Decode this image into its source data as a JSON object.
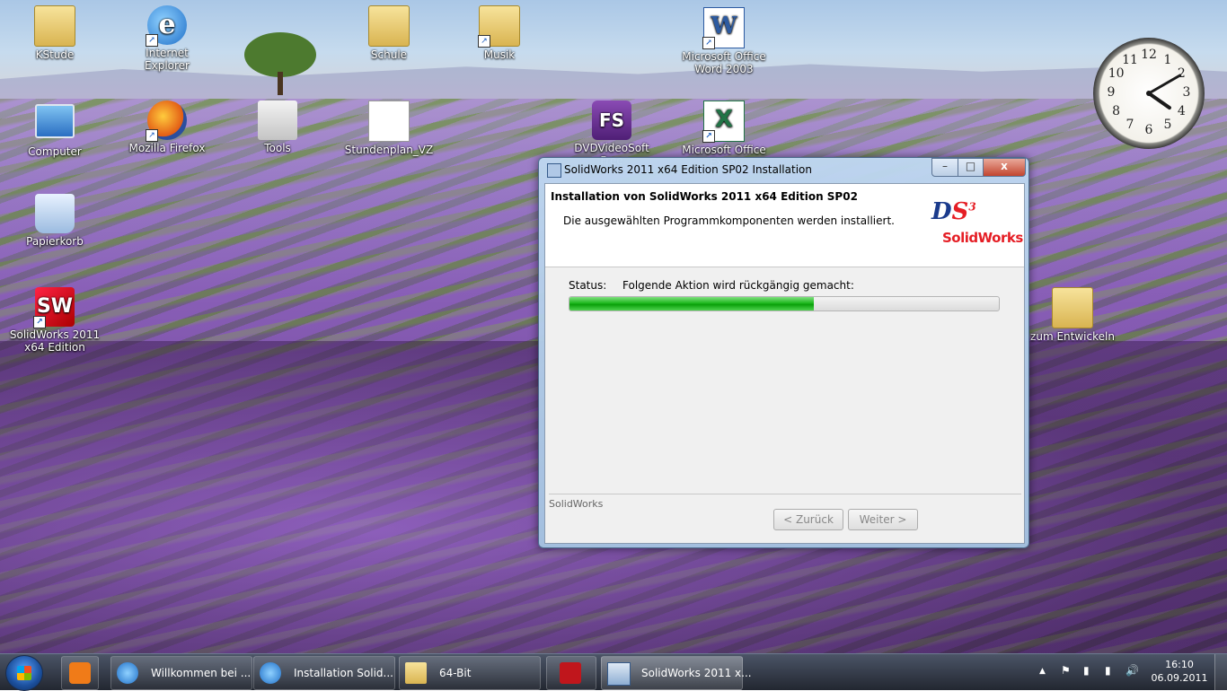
{
  "desktop_icons": [
    {
      "name": "KStude",
      "type": "folder"
    },
    {
      "name": "Internet Explorer",
      "type": "ie"
    },
    {
      "name": "Schule",
      "type": "folder"
    },
    {
      "name": "Musik",
      "type": "folder"
    },
    {
      "name": "Microsoft Office Word 2003",
      "type": "word"
    },
    {
      "name": "Computer",
      "type": "pc"
    },
    {
      "name": "Mozilla Firefox",
      "type": "ff"
    },
    {
      "name": "Tools",
      "type": "house"
    },
    {
      "name": "Stundenplan_VZ",
      "type": "doc"
    },
    {
      "name": "DVDVideoSoft Free",
      "type": "fs"
    },
    {
      "name": "Microsoft Office Excel",
      "type": "excel"
    },
    {
      "name": "Papierkorb",
      "type": "bin"
    },
    {
      "name": "SolidWorks 2011 x64 Edition",
      "type": "sw"
    },
    {
      "name": "zum Entwickeln",
      "type": "folder"
    }
  ],
  "icon_glyphs": {
    "ie": "e",
    "sw": "SW",
    "fs": "FS",
    "word": "W",
    "excel": "X",
    "shortcut": "↗"
  },
  "clock_gadget": {
    "numbers": [
      "12",
      "1",
      "2",
      "3",
      "4",
      "5",
      "6",
      "7",
      "8",
      "9",
      "10",
      "11"
    ],
    "hour": 4,
    "minute": 10
  },
  "window": {
    "title": "SolidWorks 2011 x64 Edition SP02 Installation",
    "controls": {
      "minimize": "–",
      "maximize": "□",
      "close": "x"
    },
    "header_title": "Installation von SolidWorks 2011 x64 Edition SP02",
    "header_subtitle": "Die ausgewählten Programmkomponenten werden installiert.",
    "logo": {
      "ds_d": "D",
      "ds_s": "S",
      "ds_3": "3",
      "text": "SolidWorks"
    },
    "status_label": "Status:",
    "status_text": "Folgende Aktion wird rückgängig gemacht:",
    "progress": 0.57,
    "brand": "SolidWorks",
    "back_button": "< Zurück",
    "next_button": "Weiter >"
  },
  "taskbar": {
    "items": [
      {
        "label": "Willkommen bei ...",
        "icon": "ie-icon"
      },
      {
        "label": "Installation Solid...",
        "icon": "ie-icon"
      },
      {
        "label": "64-Bit",
        "icon": "folder-icon"
      },
      {
        "label": "",
        "icon": "acrobat-icon"
      },
      {
        "label": "SolidWorks 2011 x...",
        "icon": "installer-icon",
        "active": true
      }
    ],
    "tray": {
      "up": "▲",
      "flag": "⚑",
      "power": "▮",
      "signal": "▮",
      "volume": "🔊"
    },
    "time": "16:10",
    "date": "06.09.2011"
  },
  "colors": {
    "progress": "#1fb81f",
    "close": "#c2452f",
    "logo_red": "#e51e25",
    "logo_blue": "#1b3b8c"
  }
}
